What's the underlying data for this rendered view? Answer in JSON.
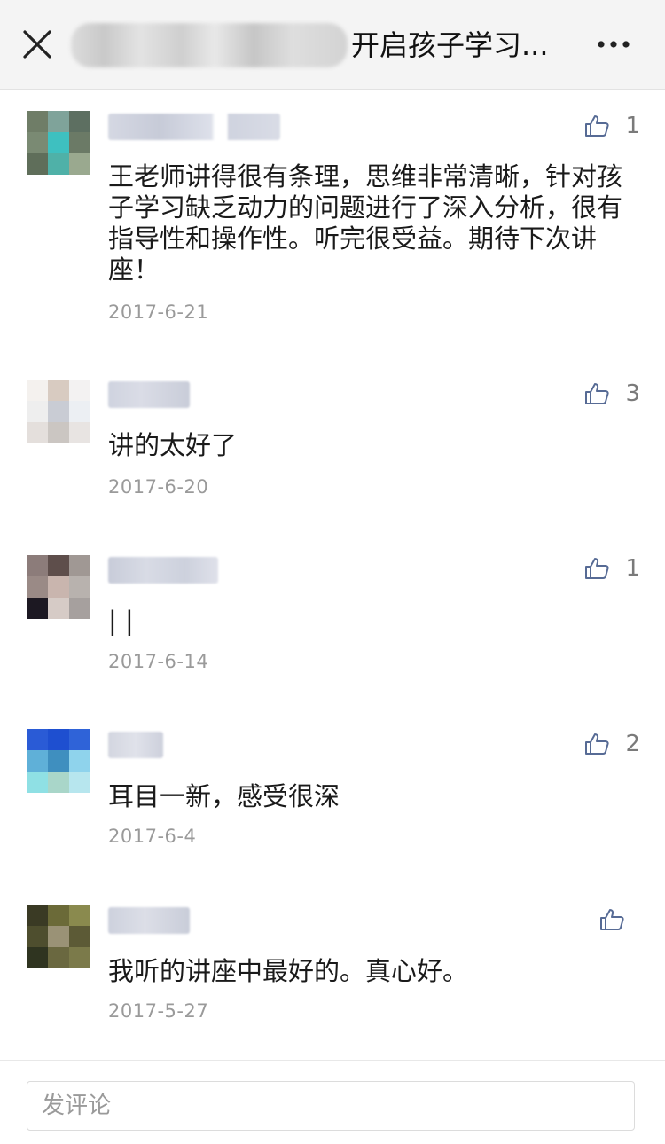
{
  "header": {
    "title": "开启孩子学习...",
    "icons": {
      "close": "close-icon",
      "more": "more-icon"
    }
  },
  "comments": [
    {
      "text": "王老师讲得很有条理，思维非常清晰，针对孩子学习缺乏动力的问题进行了深入分析，很有指导性和操作性。听完很受益。期待下次讲座！",
      "date": "2017-6-21",
      "likes": "1"
    },
    {
      "text": "讲的太好了",
      "date": "2017-6-20",
      "likes": "3"
    },
    {
      "text": "| |",
      "date": "2017-6-14",
      "likes": "1"
    },
    {
      "text": "耳目一新，感受很深",
      "date": "2017-6-4",
      "likes": "2"
    },
    {
      "text": "我听的讲座中最好的。真心好。",
      "date": "2017-5-27",
      "likes": ""
    }
  ],
  "composer": {
    "placeholder": "发评论"
  },
  "colors": {
    "accent": "#576b95",
    "date_gray": "#9a9a9a",
    "header_bg": "#f4f4f4"
  }
}
